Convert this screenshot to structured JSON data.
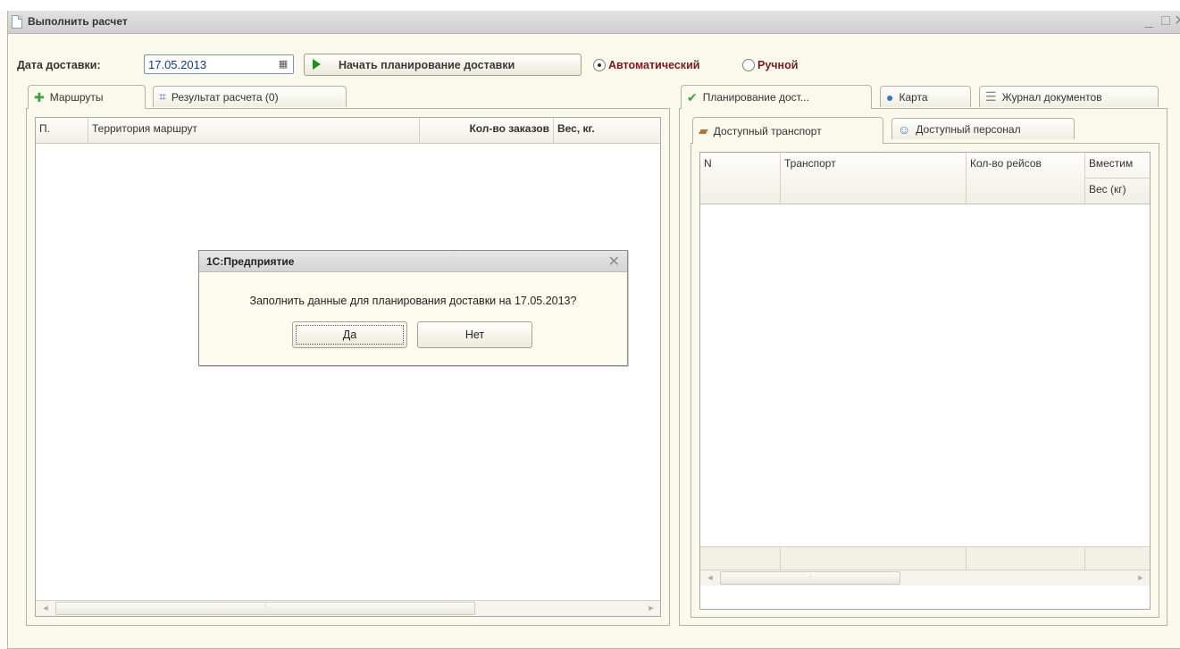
{
  "window": {
    "title": "Выполнить расчет",
    "controls": {
      "minimize": "_",
      "maximize": "□",
      "close": "✕"
    }
  },
  "toolbar": {
    "date_label": "Дата доставки:",
    "date_value": "17.05.2013",
    "start_button": "Начать планирование доставки",
    "mode_auto": "Автоматический",
    "mode_manual": "Ручной",
    "selected_mode": "Автоматический"
  },
  "left_panel": {
    "tabs": [
      {
        "label": "Маршруты",
        "icon": "puzzle-icon",
        "active": true
      },
      {
        "label": "Результат расчета (0)",
        "icon": "chart-icon",
        "active": false
      }
    ],
    "grid": {
      "columns": [
        "П.",
        "Территория маршрут",
        "Кол-во заказов",
        "Вес, кг."
      ],
      "rows": []
    }
  },
  "right_panel": {
    "tabs": [
      {
        "label": "Планирование дост...",
        "icon": "checkmark-icon",
        "active": true
      },
      {
        "label": "Карта",
        "icon": "globe-icon",
        "active": false
      },
      {
        "label": "Журнал документов",
        "icon": "document-icon",
        "active": false
      }
    ],
    "subtabs": [
      {
        "label": "Доступный транспорт",
        "icon": "truck-icon",
        "active": true
      },
      {
        "label": "Доступный персонал",
        "icon": "person-icon",
        "active": false
      }
    ],
    "grid": {
      "columns": [
        "N",
        "Транспорт",
        "Кол-во рейсов",
        "Вместим"
      ],
      "subcolumn": "Вес (кг)",
      "rows": []
    }
  },
  "dialog": {
    "title": "1С:Предприятие",
    "message": "Заполнить данные для планирования доставки на 17.05.2013?",
    "yes": "Да",
    "no": "Нет"
  },
  "colors": {
    "background": "#fbf9ec",
    "play_green": "#1f8e1f",
    "radio_text": "#7a1a1a",
    "date_text": "#133a7c"
  }
}
